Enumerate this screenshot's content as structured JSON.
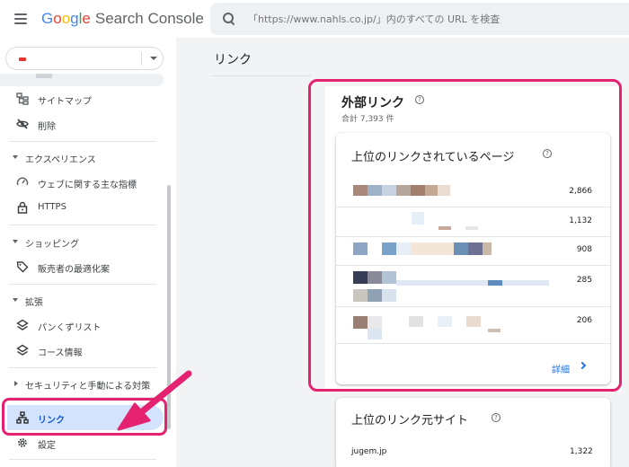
{
  "header": {
    "logo_google": [
      "G",
      "o",
      "o",
      "g",
      "l",
      "e"
    ],
    "logo_product": "Search Console",
    "search_placeholder": "「https://www.nahls.co.jp/」内のすべての URL を検査"
  },
  "sidebar": {
    "items": [
      {
        "label": "サイトマップ",
        "icon": "sitemap-icon"
      },
      {
        "label": "削除",
        "icon": "visibility-off-icon"
      }
    ],
    "section_experience": "エクスペリエンス",
    "experience_items": [
      {
        "label": "ウェブに関する主な指標",
        "icon": "speed-icon"
      },
      {
        "label": "HTTPS",
        "icon": "lock-icon"
      }
    ],
    "section_shopping": "ショッピング",
    "shopping_items": [
      {
        "label": "販売者の最適化案",
        "icon": "tag-icon"
      }
    ],
    "section_enhancements": "拡張",
    "enhancement_items": [
      {
        "label": "パンくずリスト",
        "icon": "layers-icon"
      },
      {
        "label": "コース情報",
        "icon": "layers-icon"
      }
    ],
    "section_security": "セキュリティと手動による対策",
    "links_label": "リンク",
    "settings_label": "設定"
  },
  "main": {
    "page_title": "リンク",
    "external_links": {
      "title": "外部リンク",
      "total": "合計 7,393 件"
    },
    "top_linked_pages": {
      "title": "上位のリンクされているページ",
      "rows": [
        {
          "value": "2,866"
        },
        {
          "value": "1,132"
        },
        {
          "value": "908"
        },
        {
          "value": "285"
        },
        {
          "value": "206"
        }
      ],
      "more_label": "詳細"
    },
    "top_linking_sites": {
      "title": "上位のリンク元サイト",
      "rows": [
        {
          "site": "jugem.jp",
          "value": "1,322"
        }
      ]
    }
  },
  "colors": {
    "highlight": "#e5226f",
    "active_bg": "#d3e3fd",
    "link_blue": "#1a73e8"
  }
}
